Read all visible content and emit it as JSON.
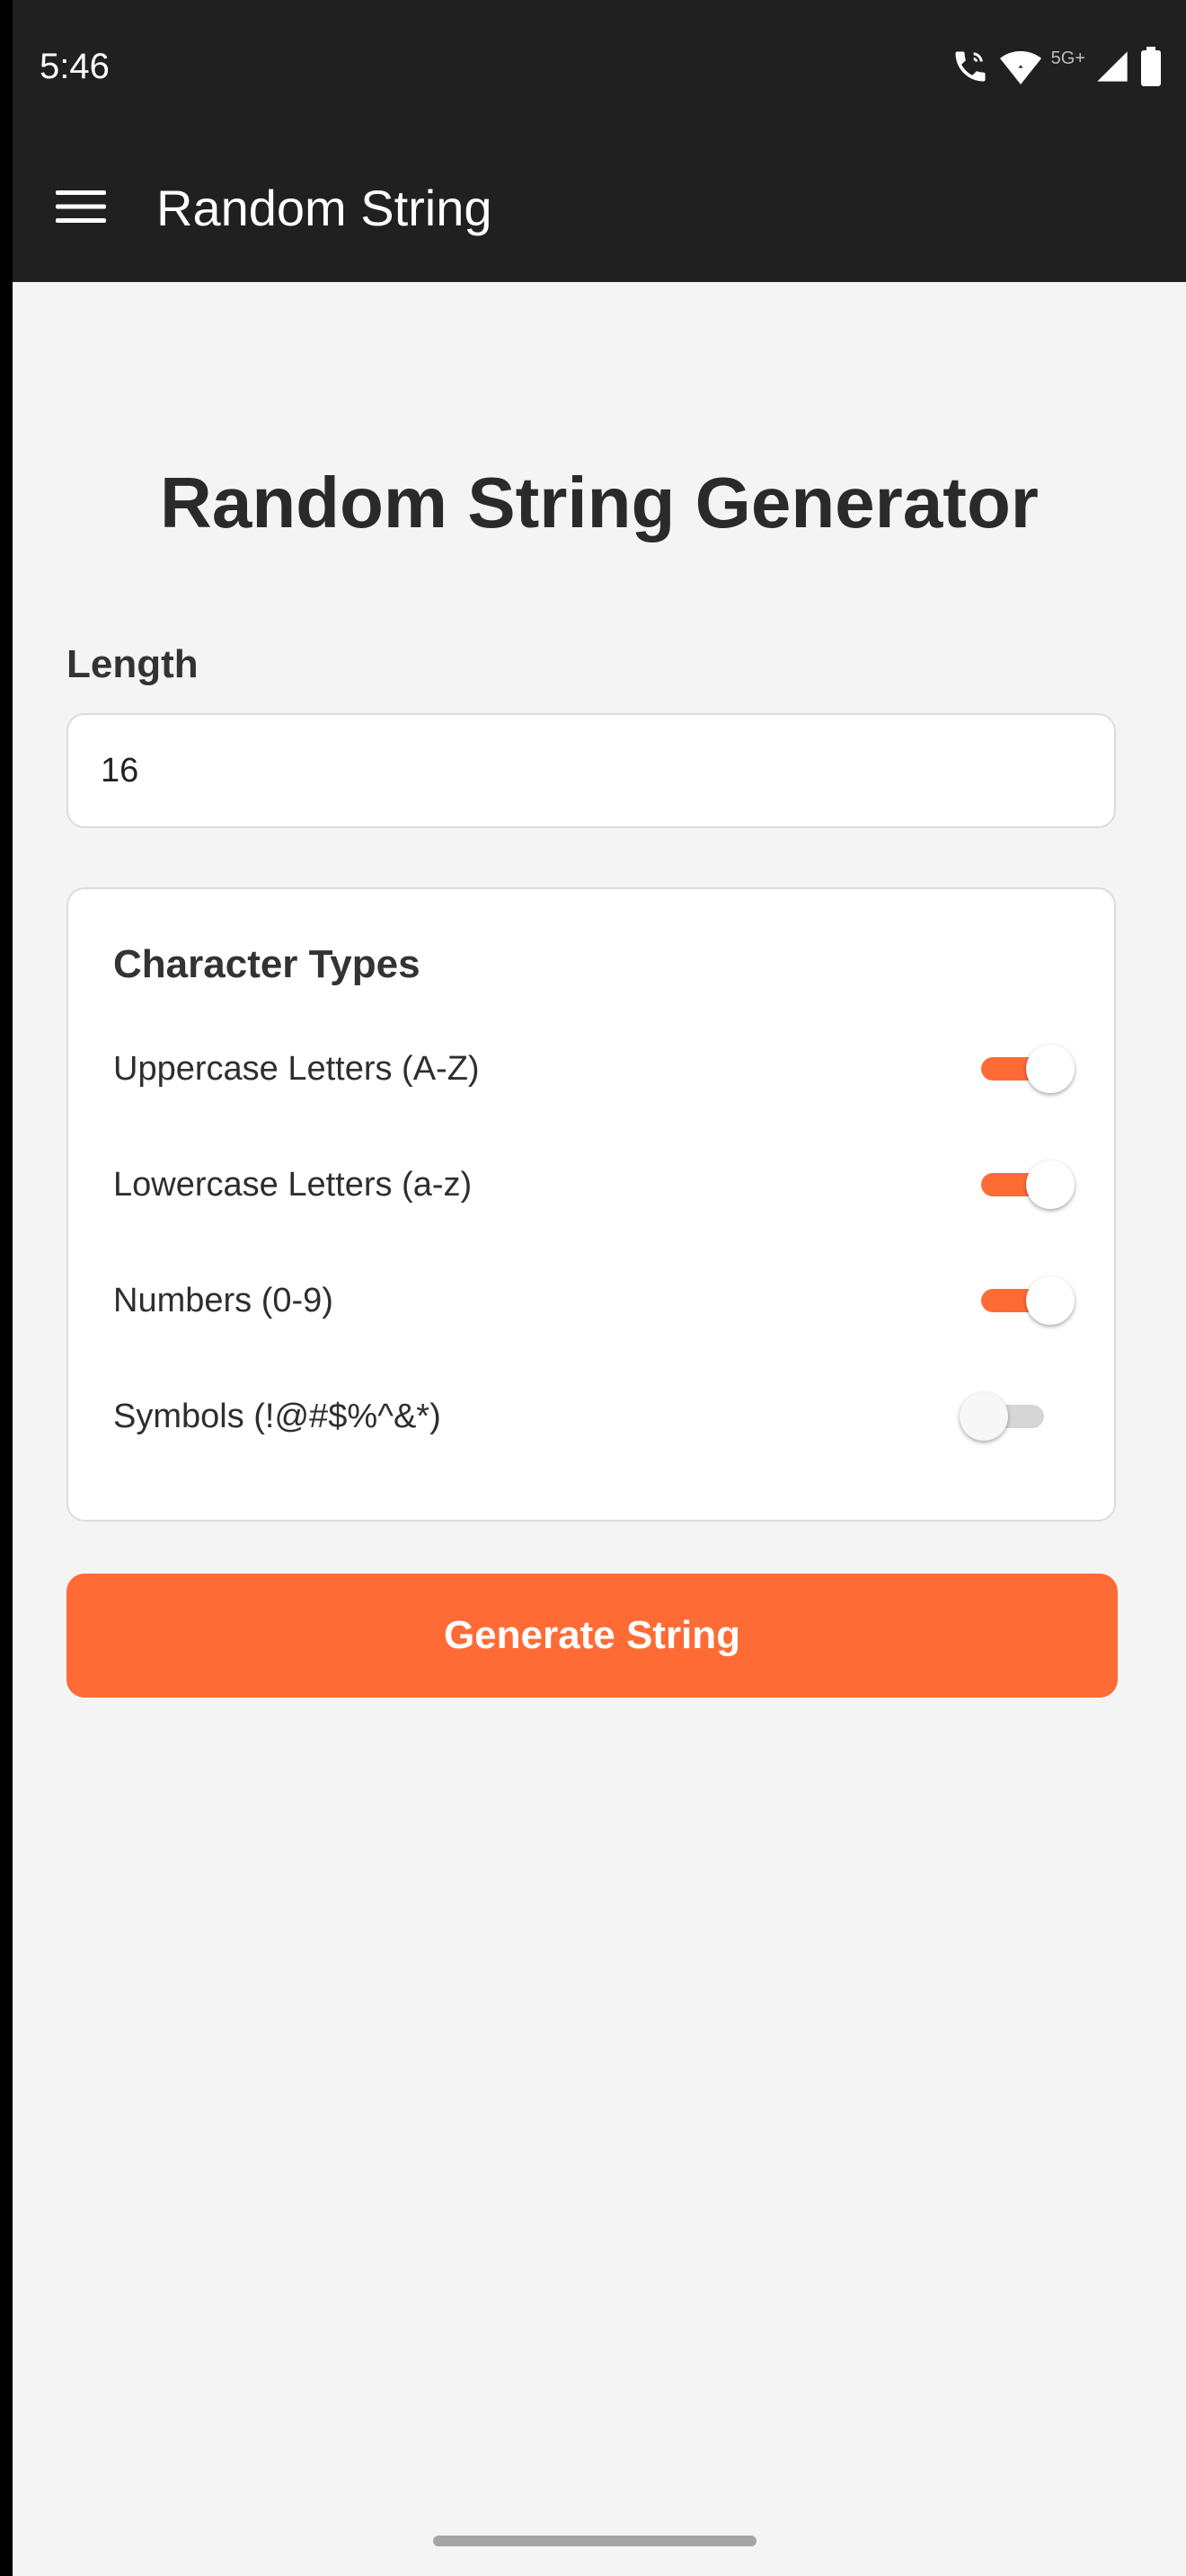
{
  "status_bar": {
    "time": "5:46",
    "network": "5G+",
    "icons": [
      "wifi-calling-icon",
      "wifi-icon",
      "signal-icon",
      "battery-icon"
    ]
  },
  "app_bar": {
    "title": "Random String",
    "menu_icon": "hamburger-menu-icon"
  },
  "main": {
    "title": "Random String Generator",
    "length": {
      "label": "Length",
      "value": "16"
    },
    "character_types": {
      "title": "Character Types",
      "options": [
        {
          "label": "Uppercase Letters (A-Z)",
          "enabled": true
        },
        {
          "label": "Lowercase Letters (a-z)",
          "enabled": true
        },
        {
          "label": "Numbers (0-9)",
          "enabled": true
        },
        {
          "label": "Symbols (!@#$%^&*)",
          "enabled": false
        }
      ]
    },
    "generate_button": "Generate String"
  },
  "colors": {
    "accent": "#ff6b35",
    "app_bar": "#202020",
    "background": "#f4f4f4",
    "card": "#ffffff"
  }
}
